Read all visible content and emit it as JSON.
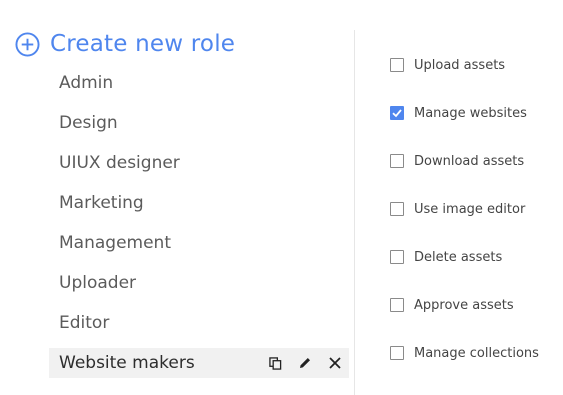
{
  "colors": {
    "accent": "#4f86ee",
    "text": "#5b5b5b",
    "selected_bg": "#f1f1f1"
  },
  "create_role": {
    "icon": "plus-circle-icon",
    "label": "Create new role"
  },
  "roles": [
    {
      "label": "Admin",
      "selected": false
    },
    {
      "label": "Design",
      "selected": false
    },
    {
      "label": "UIUX designer",
      "selected": false
    },
    {
      "label": "Marketing",
      "selected": false
    },
    {
      "label": "Management",
      "selected": false
    },
    {
      "label": "Uploader",
      "selected": false
    },
    {
      "label": "Editor",
      "selected": false
    },
    {
      "label": "Website makers",
      "selected": true
    }
  ],
  "selected_role_actions": [
    "copy-icon",
    "pencil-icon",
    "close-icon"
  ],
  "permissions": [
    {
      "label": "Upload assets",
      "checked": false
    },
    {
      "label": "Manage websites",
      "checked": true
    },
    {
      "label": "Download assets",
      "checked": false
    },
    {
      "label": "Use image editor",
      "checked": false
    },
    {
      "label": "Delete assets",
      "checked": false
    },
    {
      "label": "Approve assets",
      "checked": false
    },
    {
      "label": "Manage collections",
      "checked": false
    }
  ]
}
